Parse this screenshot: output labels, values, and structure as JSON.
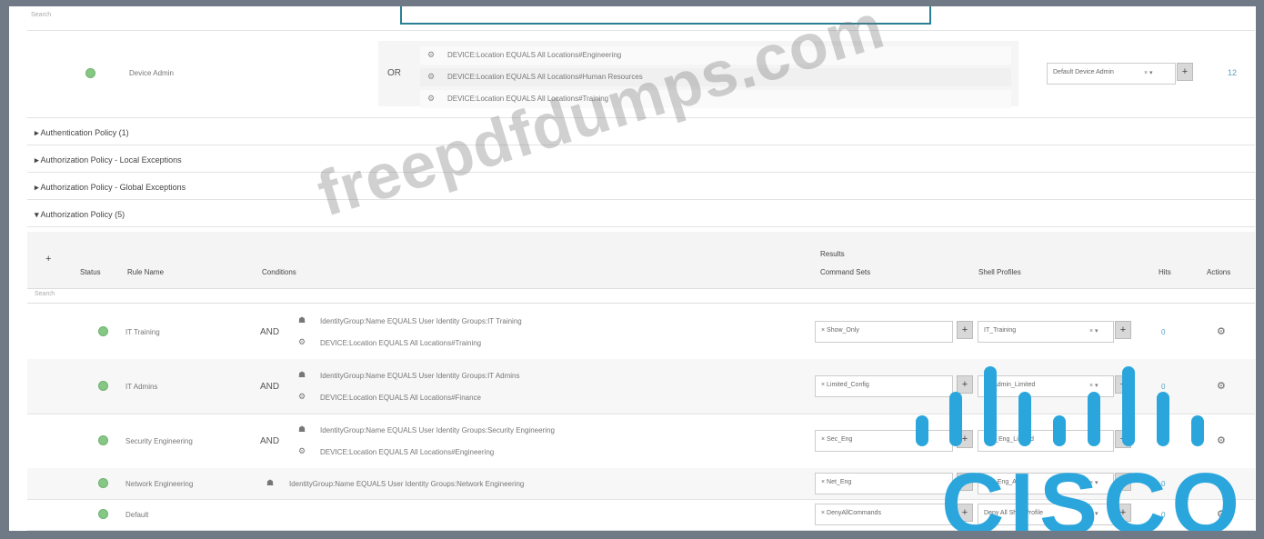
{
  "top_search": {
    "placeholder": "Search"
  },
  "device_admin": {
    "name": "Device Admin",
    "operator": "OR",
    "conditions": [
      "DEVICE:Location  EQUALS  All Locations#Engineering",
      "DEVICE:Location  EQUALS  All Locations#Human Resources",
      "DEVICE:Location  EQUALS  All Locations#Training"
    ],
    "protocol": "Default Device Admin",
    "hits": "12"
  },
  "sections": [
    "Authentication Policy (1)",
    "Authorization Policy - Local Exceptions",
    "Authorization Policy - Global Exceptions",
    "Authorization Policy (5)"
  ],
  "table": {
    "add": "+",
    "results_label": "Results",
    "headers": {
      "status": "Status",
      "rule_name": "Rule Name",
      "conditions": "Conditions",
      "command_sets": "Command Sets",
      "shell_profiles": "Shell Profiles",
      "hits": "Hits",
      "actions": "Actions"
    },
    "search_placeholder": "Search",
    "rows": [
      {
        "name": "IT Training",
        "operator": "AND",
        "conditions": [
          "IdentityGroup:Name  EQUALS  User Identity Groups:IT Training",
          "DEVICE:Location  EQUALS  All Locations#Training"
        ],
        "command_set": "× Show_Only",
        "shell_profile": "IT_Training",
        "hits": "0"
      },
      {
        "name": "IT Admins",
        "operator": "AND",
        "conditions": [
          "IdentityGroup:Name  EQUALS  User Identity Groups:IT Admins",
          "DEVICE:Location  EQUALS  All Locations#Finance"
        ],
        "command_set": "× Limited_Config",
        "shell_profile": "IT_Admin_Limited",
        "hits": "0"
      },
      {
        "name": "Security Engineering",
        "operator": "AND",
        "conditions": [
          "IdentityGroup:Name  EQUALS  User Identity Groups:Security Engineering",
          "DEVICE:Location  EQUALS  All Locations#Engineering"
        ],
        "command_set": "× Sec_Eng",
        "shell_profile": "Sec_Eng_Limited",
        "hits": "0"
      },
      {
        "name": "Network Engineering",
        "operator": "",
        "conditions": [
          "IdentityGroup:Name  EQUALS  User Identity Groups:Network Engineering"
        ],
        "command_set": "× Net_Eng",
        "shell_profile": "Net_Eng_All",
        "hits": "0"
      },
      {
        "name": "Default",
        "operator": "",
        "conditions": [],
        "command_set": "× DenyAllCommands",
        "shell_profile": "Deny All Shell Profile",
        "hits": "0"
      }
    ]
  },
  "watermark": "freepdfdumps.com",
  "logo": "CISCO",
  "colors": {
    "status_green": "#86c786",
    "accent_teal": "#2a7f95",
    "cisco_blue": "#2ba6dd"
  }
}
